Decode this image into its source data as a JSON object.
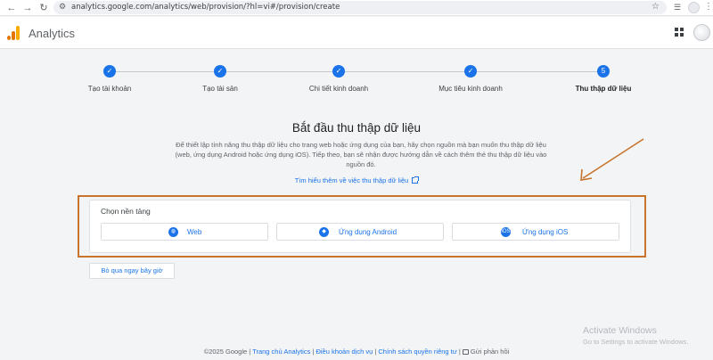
{
  "browser": {
    "url": "analytics.google.com/analytics/web/provision/?hl=vi#/provision/create"
  },
  "app": {
    "title": "Analytics"
  },
  "stepper": {
    "steps": [
      {
        "label": "Tạo tài khoản",
        "state": "done"
      },
      {
        "label": "Tạo tài sản",
        "state": "done"
      },
      {
        "label": "Chi tiết kinh doanh",
        "state": "done"
      },
      {
        "label": "Mục tiêu kinh doanh",
        "state": "done"
      },
      {
        "label": "Thu thập dữ liệu",
        "state": "active",
        "number": "5"
      }
    ]
  },
  "intro": {
    "heading": "Bắt đầu thu thập dữ liệu",
    "description": "Để thiết lập tính năng thu thập dữ liệu cho trang web hoặc ứng dụng của bạn, hãy chọn nguồn mà bạn muốn thu thập dữ liệu (web, ứng dụng Android hoặc ứng dụng iOS). Tiếp theo, bạn sẽ nhận được hướng dẫn về cách thêm thẻ thu thập dữ liệu vào nguồn đó.",
    "learn_more": "Tìm hiểu thêm về việc thu thập dữ liệu"
  },
  "platform": {
    "title": "Chọn nền tảng",
    "options": [
      {
        "label": "Web",
        "icon": "globe-icon"
      },
      {
        "label": "Ứng dụng Android",
        "icon": "android-icon"
      },
      {
        "label": "Ứng dụng iOS",
        "icon": "ios-icon"
      }
    ]
  },
  "skip_label": "Bỏ qua ngay bây giờ",
  "watermark": {
    "line1": "Activate Windows",
    "line2": "Go to Settings to activate Windows."
  },
  "footer": {
    "copyright": "©2025 Google",
    "home": "Trang chủ Analytics",
    "terms": "Điều khoản dịch vụ",
    "privacy": "Chính sách quyền riêng tư",
    "feedback": "Gửi phản hồi"
  },
  "colors": {
    "accent": "#1a73e8",
    "annotation": "#c8742c",
    "logo_orange": "#e37400",
    "logo_yellow": "#f9ab00"
  }
}
